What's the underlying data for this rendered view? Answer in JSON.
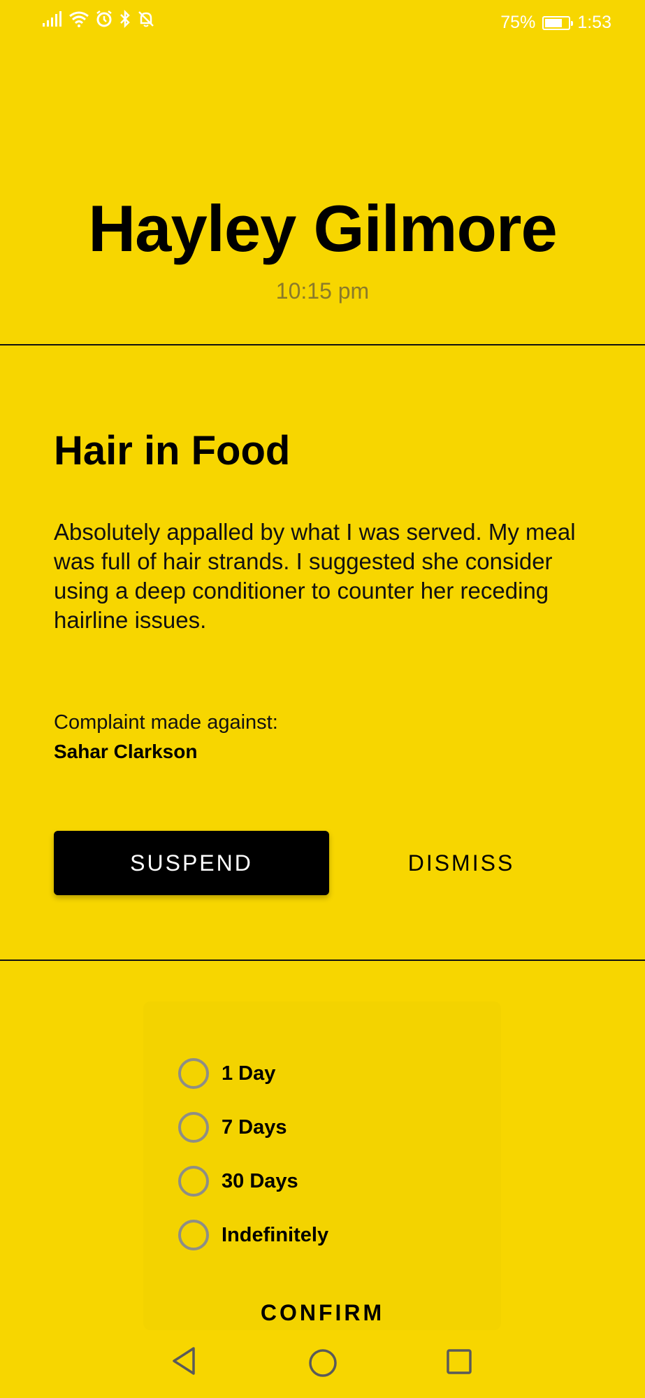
{
  "status_bar": {
    "battery": "75%",
    "battery_level": 0.75,
    "clock": "1:53"
  },
  "header": {
    "name": "Hayley Gilmore",
    "time": "10:15 pm"
  },
  "complaint": {
    "title": "Hair in Food",
    "body": "Absolutely appalled by what I was served. My meal was full of hair strands. I suggested she consider using a deep conditioner to counter her receding hairline issues.",
    "against_label": "Complaint made against:",
    "against_name": "Sahar Clarkson"
  },
  "actions": {
    "suspend_label": "SUSPEND",
    "dismiss_label": "DISMISS"
  },
  "suspension": {
    "options": [
      {
        "label": "1 Day",
        "selected": false
      },
      {
        "label": "7 Days",
        "selected": false
      },
      {
        "label": "30 Days",
        "selected": false
      },
      {
        "label": "Indefinitely",
        "selected": false
      }
    ],
    "confirm_label": "CONFIRM"
  },
  "colors": {
    "background": "#F7D600",
    "button": "#000000",
    "radio_border": "#8e8e86"
  },
  "icons": [
    "signal-icon",
    "wifi-icon",
    "alarm-icon",
    "bluetooth-icon",
    "notifications-off-icon",
    "battery-icon",
    "back-icon",
    "home-icon",
    "recents-icon"
  ]
}
